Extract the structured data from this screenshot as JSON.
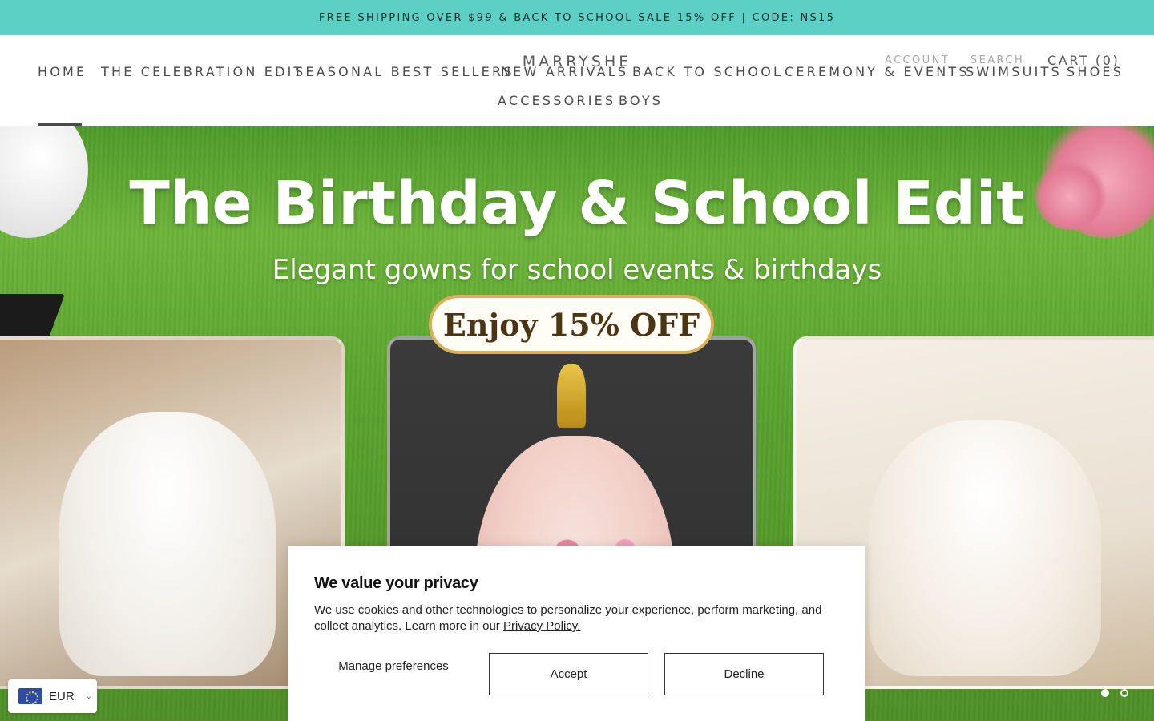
{
  "announcement": "FREE SHIPPING OVER $99 & BACK TO SCHOOL SALE 15% OFF | CODE: NS15",
  "brand": "MARRYSHE",
  "utility": {
    "account": "ACCOUNT",
    "search": "SEARCH",
    "cart": "CART (0)"
  },
  "nav": {
    "row1": [
      "HOME",
      "THE CELEBRATION EDIT",
      "SEASONAL BEST SELLERS",
      "NEW ARRIVALS",
      "BACK TO SCHOOL",
      "CEREMONY & EVENTS",
      "SWIMSUITS",
      "SHOES"
    ],
    "row2": [
      "ACCESSORIES",
      "BOYS"
    ],
    "active": "HOME"
  },
  "hero": {
    "title": "The Birthday & School Edit",
    "subtitle": "Elegant gowns for school events & birthdays",
    "badge": "Enjoy 15% OFF",
    "slides": 2,
    "active_slide": 1
  },
  "cookie_banner": {
    "title": "We value your privacy",
    "message": "We use cookies and other technologies to personalize your experience, perform marketing, and collect analytics. Learn more in our ",
    "link_text": "Privacy Policy.",
    "manage_label": "Manage preferences",
    "accept_label": "Accept",
    "decline_label": "Decline"
  },
  "currency": {
    "code": "EUR",
    "icon": "eu-flag-icon"
  },
  "colors": {
    "announcement_bg": "#5dd0c6",
    "nav_text": "#4a4a4a"
  }
}
